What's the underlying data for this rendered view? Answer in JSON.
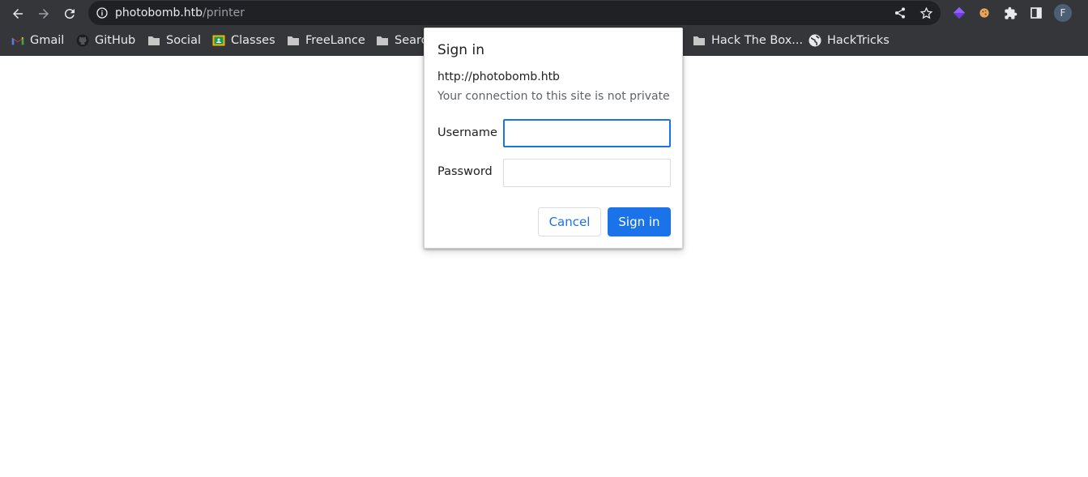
{
  "browser": {
    "address": {
      "host": "photobomb.htb",
      "path": "/printer"
    },
    "profile_initial": "F",
    "bookmarks": [
      {
        "label": "Gmail",
        "icon": "gmail-icon"
      },
      {
        "label": "GitHub",
        "icon": "github-icon"
      },
      {
        "label": "Social",
        "icon": "folder-icon"
      },
      {
        "label": "Classes",
        "icon": "classroom-icon"
      },
      {
        "label": "FreeLance",
        "icon": "folder-icon"
      },
      {
        "label": "Searc",
        "icon": "folder-icon"
      },
      {
        "label": "Hack The Box...",
        "icon": "folder-icon"
      },
      {
        "label": "HackTricks",
        "icon": "globe-icon"
      }
    ]
  },
  "dialog": {
    "title": "Sign in",
    "origin": "http://photobomb.htb",
    "warning": "Your connection to this site is not private",
    "username_label": "Username",
    "username_value": "",
    "password_label": "Password",
    "password_value": "",
    "cancel_label": "Cancel",
    "signin_label": "Sign in"
  },
  "colors": {
    "accent": "#1a73e8",
    "chrome_bg": "#35363a",
    "omnibox_bg": "#202124"
  }
}
